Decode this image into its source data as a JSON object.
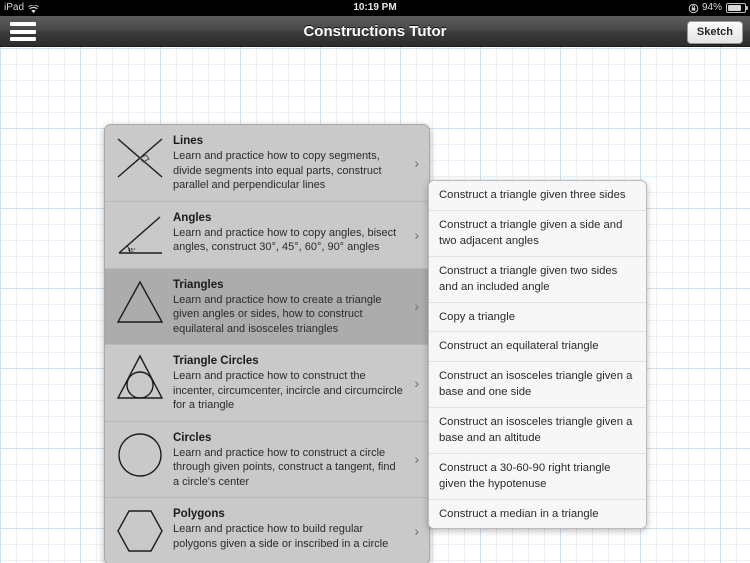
{
  "statusbar": {
    "device": "iPad",
    "wifi_icon": "wifi-icon",
    "time": "10:19 PM",
    "rotation_lock_icon": "rotation-lock-icon",
    "battery_percent": "94%",
    "battery_icon": "battery-icon"
  },
  "navbar": {
    "menu_icon": "hamburger-menu-icon",
    "title": "Constructions Tutor",
    "sketch_label": "Sketch"
  },
  "menu": {
    "items": [
      {
        "icon": "crossed-lines-icon",
        "title": "Lines",
        "description": "Learn and practice how to copy segments, divide segments into equal parts, construct parallel and perpendicular lines",
        "chevron": "›",
        "selected": false
      },
      {
        "icon": "angle-45-icon",
        "title": "Angles",
        "description": "Learn and practice how to copy angles, bisect angles, construct 30°, 45°, 60°, 90° angles",
        "chevron": "›",
        "selected": false
      },
      {
        "icon": "triangle-icon",
        "title": "Triangles",
        "description": "Learn and practice how to create a triangle given angles or sides, how to construct equilateral and isosceles triangles",
        "chevron": "›",
        "selected": true
      },
      {
        "icon": "triangle-incircle-icon",
        "title": "Triangle Circles",
        "description": "Learn and practice how to construct the incenter, circumcenter, incircle and circumcircle for a triangle",
        "chevron": "›",
        "selected": false
      },
      {
        "icon": "circle-icon",
        "title": "Circles",
        "description": "Learn and practice how to construct a circle through given points, construct a tangent, find a circle's center",
        "chevron": "›",
        "selected": false
      },
      {
        "icon": "hexagon-icon",
        "title": "Polygons",
        "description": "Learn and practice how to build regular polygons given a side or inscribed in a circle",
        "chevron": "›",
        "selected": false
      }
    ]
  },
  "submenu": {
    "items": [
      "Construct a triangle given three sides",
      "Construct a triangle given a side and two adjacent angles",
      "Construct a triangle given two sides and an included angle",
      "Copy a triangle",
      "Construct an equilateral triangle",
      "Construct an isosceles triangle given a base and one side",
      "Construct an isosceles triangle given a base and an altitude",
      "Construct a 30-60-90 right triangle given the hypotenuse",
      "Construct a median in a triangle"
    ]
  },
  "colors": {
    "navbar_dark": "#3b3b3b",
    "panel_gray": "#c9c9c9",
    "panel_selected": "#acacac",
    "submenu_bg": "#f7f7f7",
    "grid_minor": "#eaf1f8",
    "grid_major": "#cfe0ef"
  }
}
